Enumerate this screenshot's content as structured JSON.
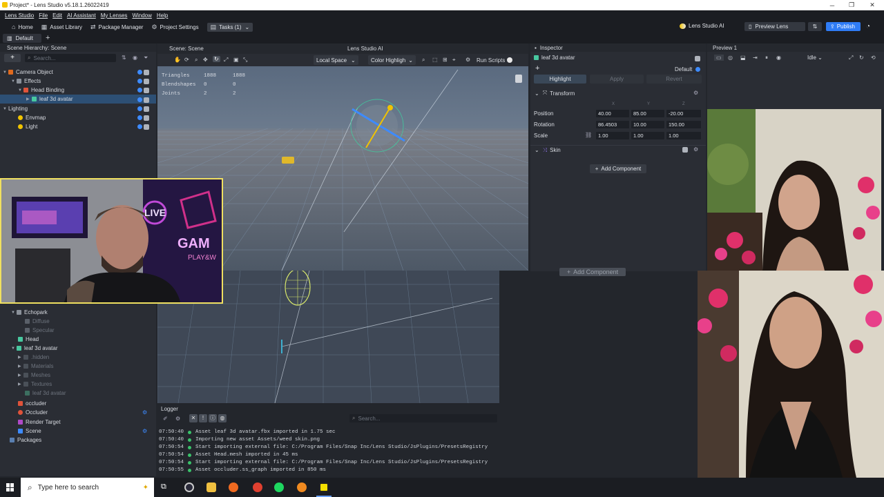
{
  "window": {
    "title": "Project* - Lens Studio v5.18.1.26022419"
  },
  "menu": [
    "Lens Studio",
    "File",
    "Edit",
    "AI Assistant",
    "My Lenses",
    "Window",
    "Help"
  ],
  "toolbar": {
    "home": "Home",
    "asset_library": "Asset Library",
    "package_manager": "Package Manager",
    "project_settings": "Project Settings",
    "tasks": "Tasks (1)",
    "lens_studio_ai": "Lens Studio AI",
    "preview_lens": "Preview Lens",
    "publish": "Publish"
  },
  "tabs": {
    "default": "Default"
  },
  "hierarchy": {
    "title": "Scene Hierarchy: Scene",
    "search_placeholder": "Search...",
    "items": [
      {
        "label": "Camera Object"
      },
      {
        "label": "Effects"
      },
      {
        "label": "Head Binding"
      },
      {
        "label": "leaf 3d avatar"
      },
      {
        "label": "Lighting"
      },
      {
        "label": "Envmap"
      },
      {
        "label": "Light"
      }
    ]
  },
  "assets": {
    "items": [
      {
        "label": "Echopark"
      },
      {
        "label": "Diffuse"
      },
      {
        "label": "Specular"
      },
      {
        "label": "Head"
      },
      {
        "label": "leaf 3d avatar"
      },
      {
        "label": ".hidden"
      },
      {
        "label": "Materials"
      },
      {
        "label": "Meshes"
      },
      {
        "label": "Textures"
      },
      {
        "label": "leaf 3d avatar"
      },
      {
        "label": "occluder"
      },
      {
        "label": "Occluder"
      },
      {
        "label": "Render Target"
      },
      {
        "label": "Scene"
      },
      {
        "label": "Packages"
      }
    ]
  },
  "scene": {
    "title": "Scene: Scene",
    "ai_tab": "Lens Studio AI",
    "space": "Local Space",
    "highlight": "Color Highligh",
    "run_scripts": "Run Scripts",
    "stats": [
      {
        "label": "Triangles",
        "a": "1888",
        "b": "1888"
      },
      {
        "label": "Blendshapes",
        "a": "0",
        "b": "0"
      },
      {
        "label": "Joints",
        "a": "2",
        "b": "2"
      }
    ]
  },
  "inspector": {
    "title": "Inspector",
    "object": "leaf 3d avatar",
    "layer": "Default",
    "highlight": "Highlight",
    "apply": "Apply",
    "revert": "Revert",
    "transform": "Transform",
    "axes": [
      "X",
      "Y",
      "Z"
    ],
    "position_label": "Position",
    "rotation_label": "Rotation",
    "scale_label": "Scale",
    "position": [
      "40.00",
      "85.00",
      "-20.00"
    ],
    "rotation": [
      "86.4503",
      "10.00",
      "150.00"
    ],
    "scale": [
      "1.00",
      "1.00",
      "1.00"
    ],
    "skin": "Skin",
    "add_component": "Add Component",
    "add_component_ghost": "Add Component"
  },
  "preview": {
    "title": "Preview 1",
    "state": "Idle"
  },
  "logger": {
    "title": "Logger",
    "search_placeholder": "Search...",
    "lines": [
      {
        "time": "07:50:40",
        "text": "Asset leaf 3d avatar.fbx imported in 1.75 sec"
      },
      {
        "time": "07:50:40",
        "text": "Importing new asset Assets/weed skin.png"
      },
      {
        "time": "07:50:54",
        "text": "Start importing external file: C:/Program Files/Snap Inc/Lens Studio/JsPlugins/PresetsRegistry"
      },
      {
        "time": "07:50:54",
        "text": "Asset Head.mesh imported in 45 ms"
      },
      {
        "time": "07:50:54",
        "text": "Start importing external file: C:/Program Files/Snap Inc/Lens Studio/JsPlugins/PresetsRegistry"
      },
      {
        "time": "07:50:55",
        "text": "Asset occluder.ss_graph imported in 850 ms"
      }
    ]
  },
  "webcam": {
    "badge": "LIVE",
    "sign": "GAM",
    "sign_sub": "PLAY&W"
  },
  "taskbar": {
    "search": "Type here to search"
  },
  "colors": {
    "accent": "#3d8bff",
    "publish": "#2f7cf6",
    "log_ok": "#39c36a"
  }
}
